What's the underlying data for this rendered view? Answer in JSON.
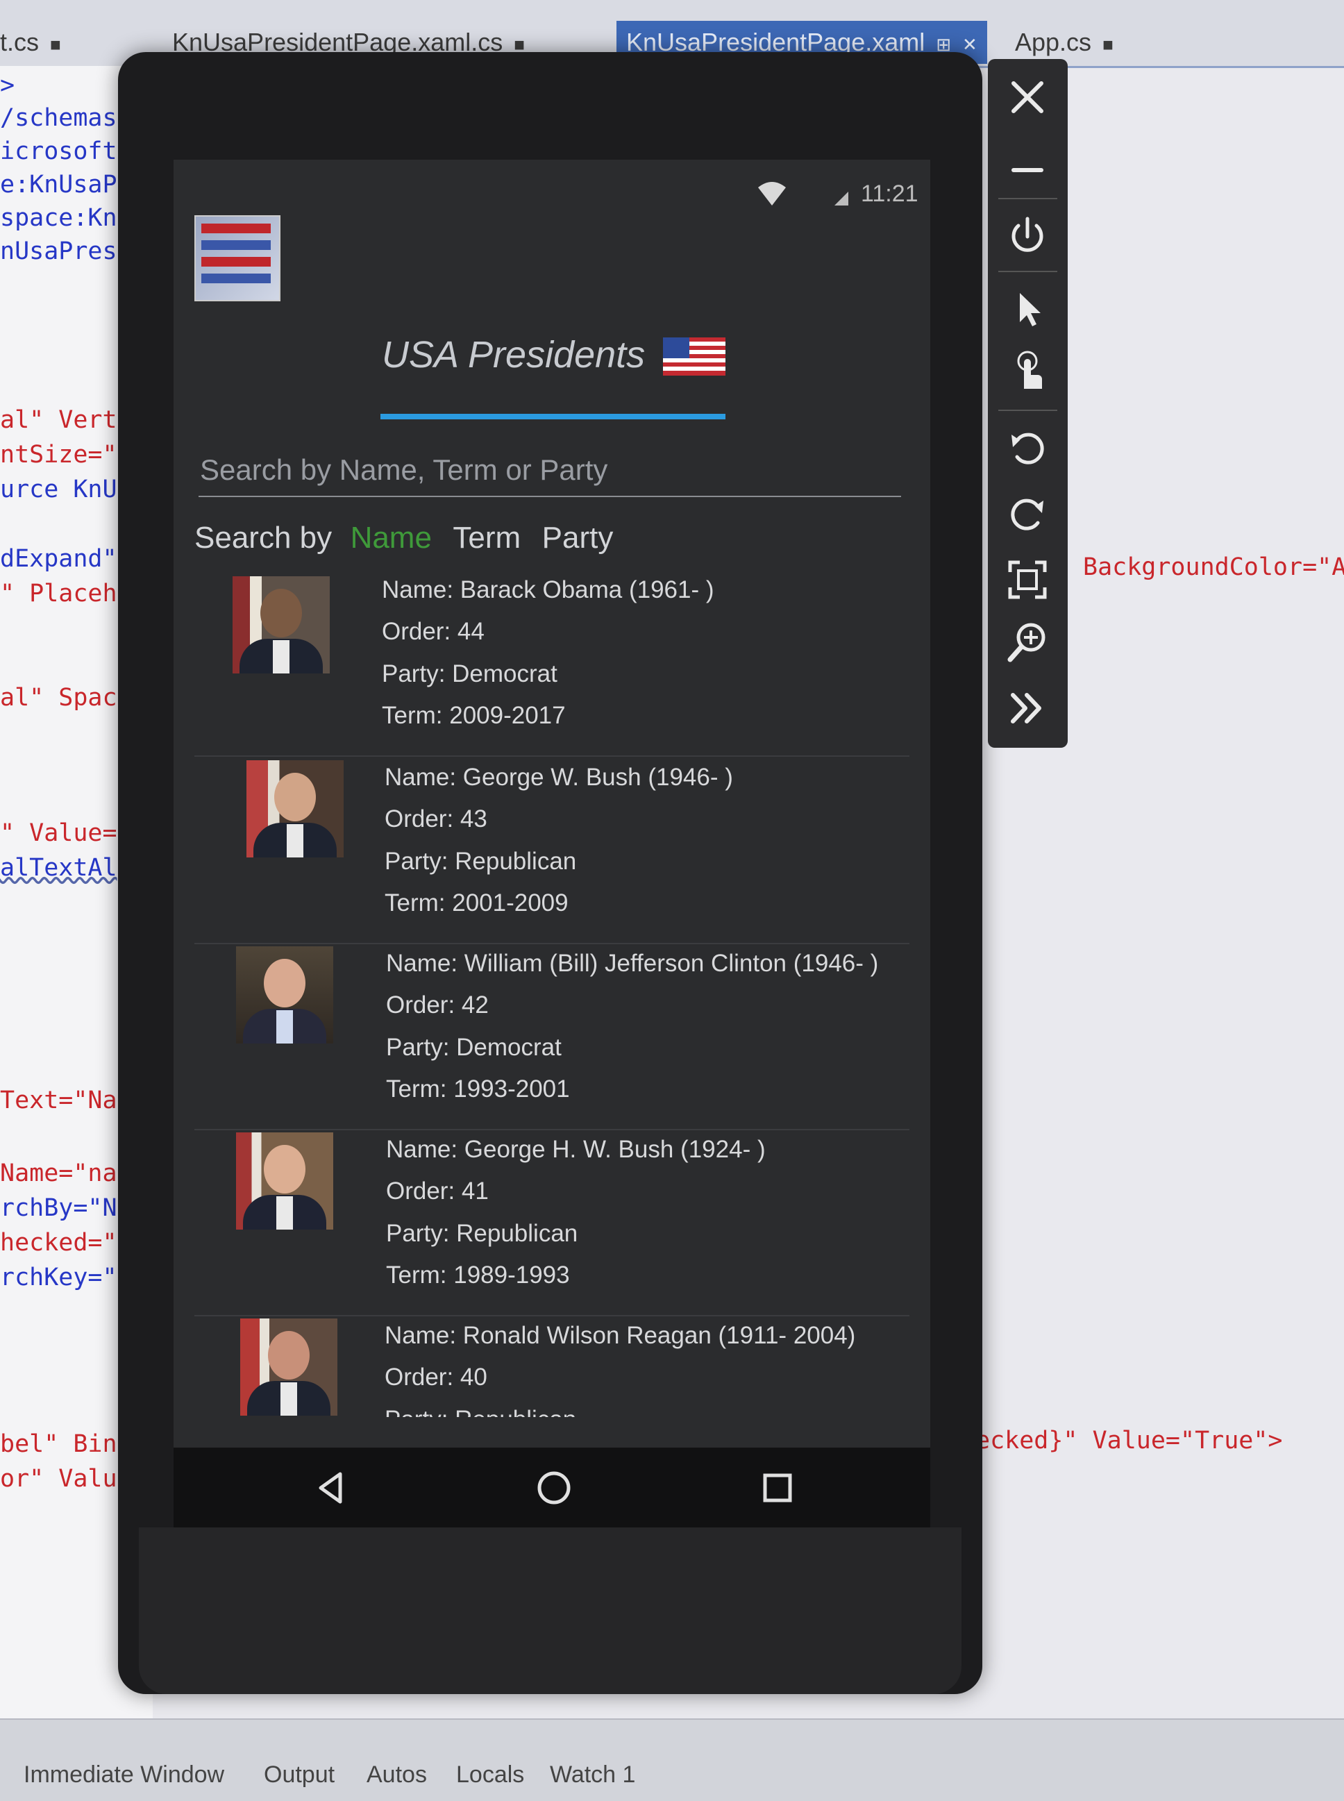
{
  "ide": {
    "tabs": [
      {
        "label": "t.cs",
        "active": false
      },
      {
        "label": "KnUsaPresidentPage.xaml.cs",
        "active": false
      },
      {
        "label": "KnUsaPresidentPage.xaml",
        "active": true
      },
      {
        "label": "App.cs",
        "active": false
      }
    ],
    "code_left": [
      {
        "text": ">",
        "color": "blue"
      },
      {
        "text": "/schemas",
        "color": "blue"
      },
      {
        "text": "icrosoft",
        "color": "blue"
      },
      {
        "text": "e:KnUsaP",
        "color": "blue"
      },
      {
        "text": "space:Kn",
        "color": "blue"
      },
      {
        "text": "nUsaPres",
        "color": "blue"
      },
      {
        "text": "al\" Vert",
        "color": "red"
      },
      {
        "text": "ntSize=\"",
        "color": "red"
      },
      {
        "text": "urce KnU",
        "color": "blue"
      },
      {
        "text": "dExpand\"",
        "color": "blue"
      },
      {
        "text": "\" Placeh",
        "color": "red"
      },
      {
        "text": "al\" Spac",
        "color": "red"
      },
      {
        "text": "\" Value=",
        "color": "red"
      },
      {
        "text": "alTextAl",
        "color": "ul"
      },
      {
        "text": "Text=\"Na",
        "color": "red"
      },
      {
        "text": "Name=\"nam",
        "color": "red"
      },
      {
        "text": "rchBy=\"N",
        "color": "blue"
      },
      {
        "text": "hecked=\"",
        "color": "red"
      },
      {
        "text": "rchKey=\"",
        "color": "blue"
      },
      {
        "text": "bel\" Bind",
        "color": "red"
      },
      {
        "text": "or\" Value",
        "color": "red"
      }
    ],
    "code_right": [
      {
        "text": "BackgroundColor=\"A"
      },
      {
        "text": "ecked}\" Value=\"True\">"
      }
    ],
    "bottom_tabs": [
      "Immediate Window",
      "Output",
      "Autos",
      "Locals",
      "Watch 1"
    ]
  },
  "device": {
    "status_time": "11:21",
    "page_title": "USA Presidents",
    "search_placeholder": "Search by Name, Term or Party",
    "search_value": "",
    "search_by_label": "Search by",
    "search_by_options": [
      {
        "label": "Name",
        "selected": true
      },
      {
        "label": "Term",
        "selected": false
      },
      {
        "label": "Party",
        "selected": false
      }
    ],
    "presidents": [
      {
        "name": "Name: Barack Obama (1961- )",
        "order": "Order: 44",
        "party": "Party: Democrat",
        "term": "Term: 2009-2017"
      },
      {
        "name": "Name: George W. Bush (1946- )",
        "order": "Order: 43",
        "party": "Party: Republican",
        "term": "Term: 2001-2009"
      },
      {
        "name": "Name: William (Bill) Jefferson Clinton (1946- )",
        "order": "Order: 42",
        "party": "Party: Democrat",
        "term": "Term: 1993-2001"
      },
      {
        "name": "Name: George H. W. Bush (1924- )",
        "order": "Order: 41",
        "party": "Party: Republican",
        "term": "Term: 1989-1993"
      },
      {
        "name": "Name: Ronald Wilson Reagan (1911- 2004)",
        "order": "Order: 40",
        "party": "Party: Republican",
        "term": ""
      }
    ],
    "nav_buttons": [
      "back-icon",
      "home-icon",
      "recents-icon"
    ]
  },
  "emulator_toolbar": [
    "close-icon",
    "minimize-icon",
    "power-icon",
    "pointer-icon",
    "touch-icon",
    "rotate-left-icon",
    "rotate-right-icon",
    "fit-screen-icon",
    "zoom-icon",
    "more-tools-icon"
  ],
  "colors": {
    "accent": "#2b9be0",
    "selected_option": "#3f9a3a",
    "screen_bg": "#2b2c2e"
  }
}
